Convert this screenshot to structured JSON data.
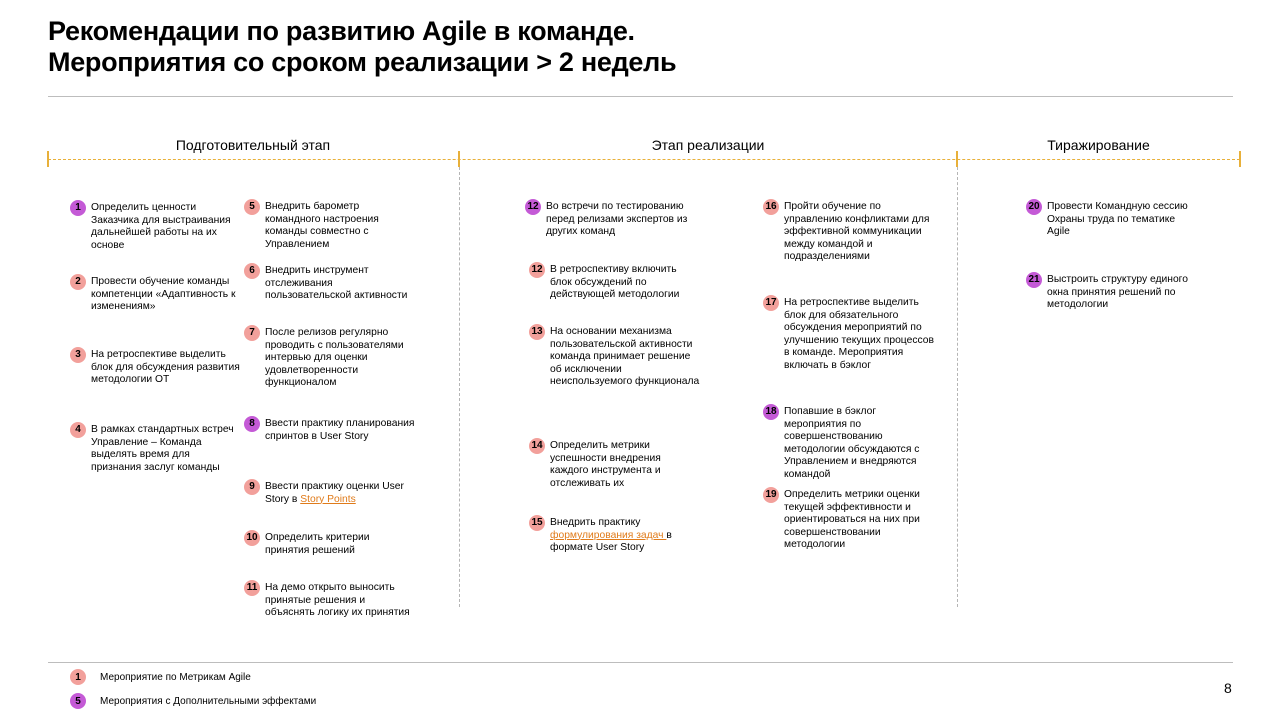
{
  "title": {
    "line1": "Рекомендации по развитию Agile в команде.",
    "line2": "Мероприятия со сроком реализации > 2 недель"
  },
  "phases": [
    {
      "label": "Подготовительный этап"
    },
    {
      "label": "Этап реализации"
    },
    {
      "label": "Тиражирование"
    }
  ],
  "colors": {
    "metrics_badge": "#f2a09b",
    "effects_badge": "#c45ad6",
    "timeline": "#e8b03a",
    "link": "#e07b1a"
  },
  "items": [
    {
      "num": "1",
      "type": "effects",
      "text": "Определить ценности Заказчика для выстраивания дальнейшей работы на их основе"
    },
    {
      "num": "2",
      "type": "metrics",
      "text": "Провести обучение команды компетенции «Адаптивность к изменениям»"
    },
    {
      "num": "3",
      "type": "metrics",
      "text": "На  ретроспективе выделить блок для обсуждения развития методологии ОТ"
    },
    {
      "num": "4",
      "type": "metrics",
      "text": "В рамках стандартных встреч Управление – Команда выделять время для признания заслуг команды"
    },
    {
      "num": "5",
      "type": "metrics",
      "text": "Внедрить барометр командного настроения команды совместно с Управлением"
    },
    {
      "num": "6",
      "type": "metrics",
      "text": "Внедрить инструмент отслеживания пользовательской активности"
    },
    {
      "num": "7",
      "type": "metrics",
      "text": "После релизов регулярно проводить с пользователями интервью для оценки удовлетворенности функционалом"
    },
    {
      "num": "8",
      "type": "effects",
      "text": "Ввести практику планирования спринтов в User Story"
    },
    {
      "num": "9",
      "type": "metrics",
      "text_before": "Ввести практику оценки User Story в ",
      "link": "Story Points",
      "text_after": ""
    },
    {
      "num": "10",
      "type": "metrics",
      "text": "Определить критерии принятия решений"
    },
    {
      "num": "11",
      "type": "metrics",
      "text": "На  демо открыто выносить принятые решения и объяснять логику их принятия"
    },
    {
      "num": "12",
      "type": "effects",
      "text": "Во встречи по тестированию перед релизами экспертов из других команд"
    },
    {
      "num": "12",
      "type": "metrics",
      "text": "В ретроспективу включить блок обсуждений по действующей методологии"
    },
    {
      "num": "13",
      "type": "metrics",
      "text": "На  основании механизма пользовательской активности команда принимает решение об исключении неиспользуемого функционала"
    },
    {
      "num": "14",
      "type": "metrics",
      "text": "Определить метрики успешности внедрения каждого инструмента и отслеживать их"
    },
    {
      "num": "15",
      "type": "metrics",
      "text_before": "Внедрить практику ",
      "link": "формулирования задач ",
      "text_after": "в формате User Story"
    },
    {
      "num": "16",
      "type": "metrics",
      "text": "Пройти обучение по управлению конфликтами для эффективной коммуникации между командой и подразделениями"
    },
    {
      "num": "17",
      "type": "metrics",
      "text": "На  ретроспективе выделить блок для обязательного обсуждения мероприятий по улучшению текущих процессов в команде. Мероприятия включать в бэклог"
    },
    {
      "num": "18",
      "type": "effects",
      "text": "Попавшие в бэклог мероприятия по совершенствованию методологии обсуждаются с Управлением и внедряются командой"
    },
    {
      "num": "19",
      "type": "metrics",
      "text": "Определить метрики оценки текущей эффективности и ориентироваться на них при совершенствовании методологии"
    },
    {
      "num": "20",
      "type": "effects",
      "text": "Провести Командную сессию Охраны труда по тематике Agile"
    },
    {
      "num": "21",
      "type": "effects",
      "text": "Выстроить структуру единого окна принятия решений по методологии"
    }
  ],
  "legend": [
    {
      "num": "1",
      "type": "metrics",
      "label": "Мероприятие по Метрикам Agile"
    },
    {
      "num": "5",
      "type": "effects",
      "label": "Мероприятия с Дополнительными эффектами"
    }
  ],
  "page_number": "8"
}
